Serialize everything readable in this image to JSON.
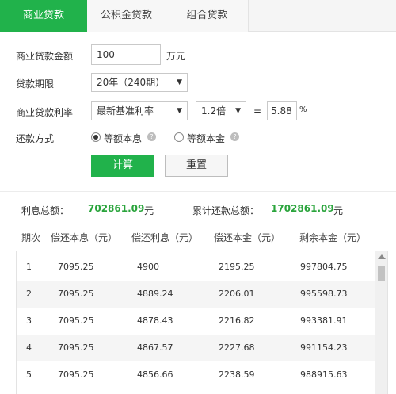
{
  "tabs": [
    {
      "label": "商业贷款",
      "active": true
    },
    {
      "label": "公积金贷款",
      "active": false
    },
    {
      "label": "组合贷款",
      "active": false
    }
  ],
  "form": {
    "amount_label": "商业贷款金额",
    "amount_value": "100",
    "amount_unit": "万元",
    "term_label": "贷款期限",
    "term_value": "20年（240期）",
    "rate_label": "商业贷款利率",
    "rate_type_value": "最新基准利率",
    "rate_multiplier_value": "1.2倍",
    "equals_sign": "=",
    "rate_result_value": "5.88",
    "percent_sign": "%",
    "repay_label": "还款方式",
    "repay_option_1": "等额本息",
    "repay_option_2": "等额本金",
    "repay_selected": "等额本息",
    "help_glyph": "?",
    "calc_button": "计算",
    "reset_button": "重置"
  },
  "summary": {
    "interest_label": "利息总额：",
    "interest_value": "702861.09",
    "interest_unit": "元",
    "total_label": "累计还款总额：",
    "total_value": "1702861.09",
    "total_unit": "元"
  },
  "table": {
    "headers": [
      "期次",
      "偿还本息（元）",
      "偿还利息（元）",
      "偿还本金（元）",
      "剩余本金（元）"
    ],
    "rows": [
      [
        "1",
        "7095.25",
        "4900",
        "2195.25",
        "997804.75"
      ],
      [
        "2",
        "7095.25",
        "4889.24",
        "2206.01",
        "995598.73"
      ],
      [
        "3",
        "7095.25",
        "4878.43",
        "2216.82",
        "993381.91"
      ],
      [
        "4",
        "7095.25",
        "4867.57",
        "2227.68",
        "991154.23"
      ],
      [
        "5",
        "7095.25",
        "4856.66",
        "2238.59",
        "988915.63"
      ]
    ]
  },
  "colors": {
    "accent": "#21b24b",
    "value_green": "#2aa43c"
  }
}
